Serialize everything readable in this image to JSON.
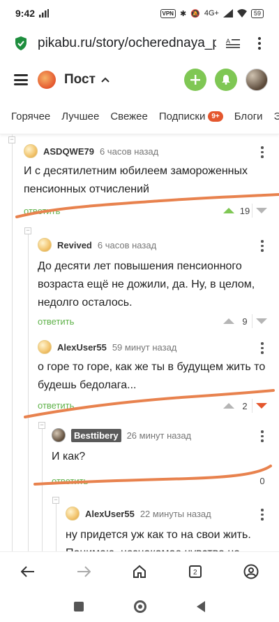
{
  "status_bar": {
    "time": "9:42",
    "vpn": "VPN",
    "net": "4G+",
    "battery": "59"
  },
  "browser": {
    "url": "pikabu.ru/story/ocherednaya_pс"
  },
  "app_header": {
    "title": "Пост"
  },
  "tabs": [
    {
      "label": "Горячее"
    },
    {
      "label": "Лучшее"
    },
    {
      "label": "Свежее"
    },
    {
      "label": "Подписки",
      "badge": "9+"
    },
    {
      "label": "Блоги"
    },
    {
      "label": "Э"
    }
  ],
  "comments": [
    {
      "author": "ASDQWE79",
      "time": "6 часов назад",
      "text_lines": [
        "И с десятилетним юбилеем замороженных",
        "пенсионных отчислений"
      ],
      "reply": "ответить",
      "votes": "19",
      "vote_state": "up"
    },
    {
      "author": "Revived",
      "time": "6 часов назад",
      "text_lines": [
        "До десяти лет повышения пенсионного",
        "возраста ещё не дожили, да. Ну, в целом,",
        "недолго осталось."
      ],
      "reply": "ответить",
      "votes": "9",
      "vote_state": "none"
    },
    {
      "author": "AlexUser55",
      "time": "59 минут назад",
      "text_lines": [
        "о горе то горе, как же ты в будущем жить то",
        "будешь бедолага..."
      ],
      "reply": "ответить",
      "votes": "2",
      "vote_state": "down"
    },
    {
      "author": "Besttibery",
      "time": "26 минут назад",
      "text_lines": [
        "И как?"
      ],
      "reply": "ответить",
      "votes": "0",
      "vote_state": "none"
    },
    {
      "author": "AlexUser55",
      "time": "22 минуты назад",
      "text_lines": [
        "ну придется уж как то на свои жить.",
        "Понимаю, незнакомое чувство на"
      ]
    }
  ],
  "colors": {
    "accent_green": "#7fc754",
    "reply_green": "#5fb24a",
    "downvote_red": "#e4572e",
    "scribble": "#e8824e"
  }
}
